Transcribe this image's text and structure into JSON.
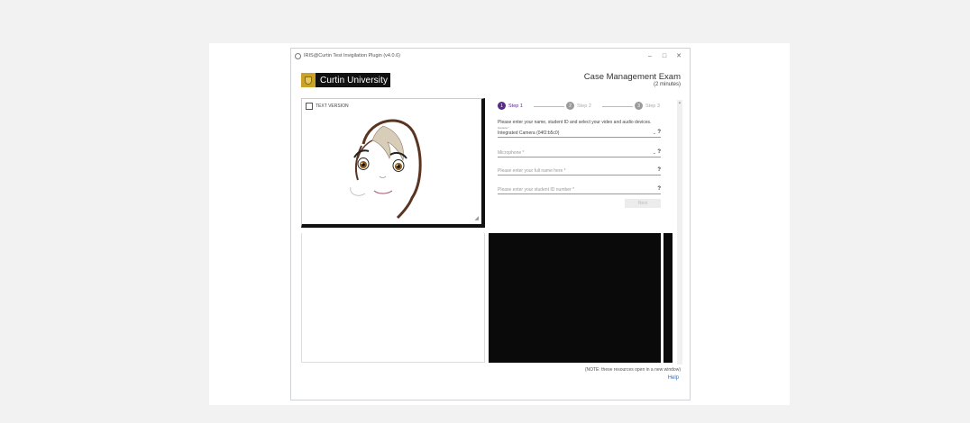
{
  "window": {
    "title": "IRIS@Curtin Test Invigilation Plugin (v4.0.6)",
    "controls": [
      "–",
      "□",
      "✕"
    ]
  },
  "header": {
    "logo_text": "Curtin University",
    "exam_title": "Case Management Exam",
    "exam_duration": "(2 minutes)"
  },
  "avatar_panel": {
    "text_version_label": "TEXT VERSION"
  },
  "stepper": {
    "steps": [
      {
        "num": "1",
        "label": "Step 1"
      },
      {
        "num": "2",
        "label": "Step 2"
      },
      {
        "num": "3",
        "label": "Step 3"
      }
    ]
  },
  "form": {
    "instructions": "Please enter your name, student ID and select your video and audio devices.",
    "camera": {
      "label": "Camera *",
      "value": "Integrated Camera (04f2:b5c0)",
      "help": "?"
    },
    "microphone": {
      "placeholder": "Microphone *",
      "help": "?"
    },
    "full_name": {
      "placeholder": "Please enter your full name here *",
      "help": "?"
    },
    "student_id": {
      "placeholder": "Please enter your student ID number *",
      "help": "?"
    },
    "next_label": "Next"
  },
  "footer": {
    "note": "(NOTE: these resources open in a new window)",
    "help_label": "Help"
  },
  "colors": {
    "accent": "#5b2a86",
    "logo_gold": "#c9a227",
    "video_bg": "#0a0a0a"
  }
}
